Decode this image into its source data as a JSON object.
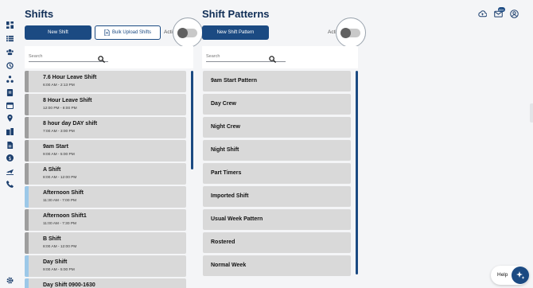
{
  "sidebar": {
    "icons": [
      "dashboard-icon",
      "list-icon",
      "people-icon",
      "clock-icon",
      "org-chart-icon",
      "document-icon",
      "calendar-icon",
      "location-pin-icon",
      "building-icon",
      "file-icon",
      "dollar-icon",
      "plane-icon",
      "phone-icon",
      "settings-icon"
    ]
  },
  "shifts": {
    "title": "Shifts",
    "new_button": "New Shift",
    "upload_button": "Bulk Upload Shifts",
    "active_label": "Acti",
    "search_placeholder": "Search",
    "items": [
      {
        "name": "7.6 Hour Leave Shift",
        "time": "6:00 AM - 2:13 PM",
        "bar": "grey"
      },
      {
        "name": "8 Hour Leave Shift",
        "time": "12:00 PM - 8:00 PM",
        "bar": "grey"
      },
      {
        "name": "8 hour day DAY shift",
        "time": "7:00 AM - 3:00 PM",
        "bar": "grey"
      },
      {
        "name": "9am Start",
        "time": "9:00 AM - 5:00 PM",
        "bar": "grey"
      },
      {
        "name": "A Shift",
        "time": "8:00 AM - 12:00 PM",
        "bar": "grey"
      },
      {
        "name": "Afternoon Shift",
        "time": "11:30 AM - 7:00 PM",
        "bar": "blue"
      },
      {
        "name": "Afternoon Shift1",
        "time": "11:00 AM - 7:30 PM",
        "bar": "grey"
      },
      {
        "name": "B Shift",
        "time": "8:00 AM - 12:00 PM",
        "bar": "grey"
      },
      {
        "name": "Day Shift",
        "time": "9:00 AM - 5:00 PM",
        "bar": "blue"
      },
      {
        "name": "Day Shift 0900-1630",
        "time": "",
        "bar": "blue"
      }
    ]
  },
  "patterns": {
    "title": "Shift Patterns",
    "new_button": "New Shift Pattern",
    "active_label": "Acti",
    "search_placeholder": "Search",
    "items": [
      {
        "name": "9am Start Pattern"
      },
      {
        "name": "Day Crew"
      },
      {
        "name": "Night Crew"
      },
      {
        "name": "Night Shift"
      },
      {
        "name": "Part Timers"
      },
      {
        "name": "Imported Shift"
      },
      {
        "name": "Usual Week Pattern"
      },
      {
        "name": "Rostered"
      },
      {
        "name": "Normal Week"
      }
    ]
  },
  "header": {
    "notification_count": "99+"
  },
  "help": {
    "label": "Help"
  },
  "colors": {
    "primary": "#1b4a82",
    "item_bg": "#d9d9d9",
    "bar_grey": "#9e9e9e",
    "bar_blue": "#9cc8e8"
  }
}
